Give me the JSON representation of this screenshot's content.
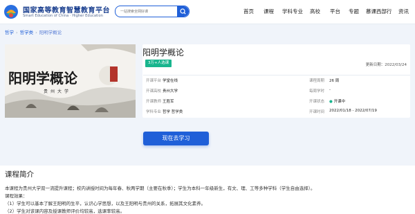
{
  "header": {
    "brand_cn": "国家高等教育智慧教育平台",
    "brand_en": "Smart Education of China · Higher Education",
    "search_placeholder": "一站搜索全网好课",
    "nav": [
      {
        "label": "首页"
      },
      {
        "label": "课程"
      },
      {
        "label": "学科专业"
      },
      {
        "label": "高校"
      },
      {
        "label": "平台"
      },
      {
        "label": "专题"
      },
      {
        "label": "慕课西部行"
      },
      {
        "label": "资讯"
      }
    ]
  },
  "breadcrumb": {
    "items": [
      "哲学",
      "哲学类",
      "阳明学概论"
    ]
  },
  "cover": {
    "title_text": "阳明学概论",
    "subtitle_text": "贵州大学"
  },
  "course": {
    "title": "阳明学概论",
    "badge": "3万+人选课",
    "updated": "更新日期：2022/03/24",
    "info_left": [
      {
        "key": "开课平台",
        "value": "学堂在线"
      },
      {
        "key": "开课高校",
        "value": "贵州大学"
      },
      {
        "key": "开课教师",
        "value": "王胜军"
      },
      {
        "key": "学科专业",
        "value": "哲学 哲学类"
      }
    ],
    "info_right": [
      {
        "key": "课程周期",
        "value": "26 周"
      },
      {
        "key": "每周学时",
        "value": "-"
      },
      {
        "key": "开课状态",
        "value": "开课中"
      },
      {
        "key": "开课时间",
        "value": "2022/01/18 - 2022/07/19"
      }
    ],
    "status_color": "#18b58e"
  },
  "actions": {
    "learn_label": "现在去学习"
  },
  "intro": {
    "title": "课程简介",
    "paragraphs": [
      "本课程为贵州大学双一流提升课程；校内讲授时间为每年春、秋两学期（主要在秋季）；学生为本科一年级新生，有文、理、工等多种学科（学生自由选择）。",
      "课程效果：",
      "（1）学生可以基本了解王阳明的生平，认识心学思想，以及王阳明与贵州的关系，拓展其文化素养。",
      "（2）学生对该课内容及授课教师评价均较高，选课率较高。"
    ]
  },
  "colors": {
    "accent": "#1f5fd8",
    "badge": "#18b58e",
    "page_bg": "#f0f4fa"
  }
}
